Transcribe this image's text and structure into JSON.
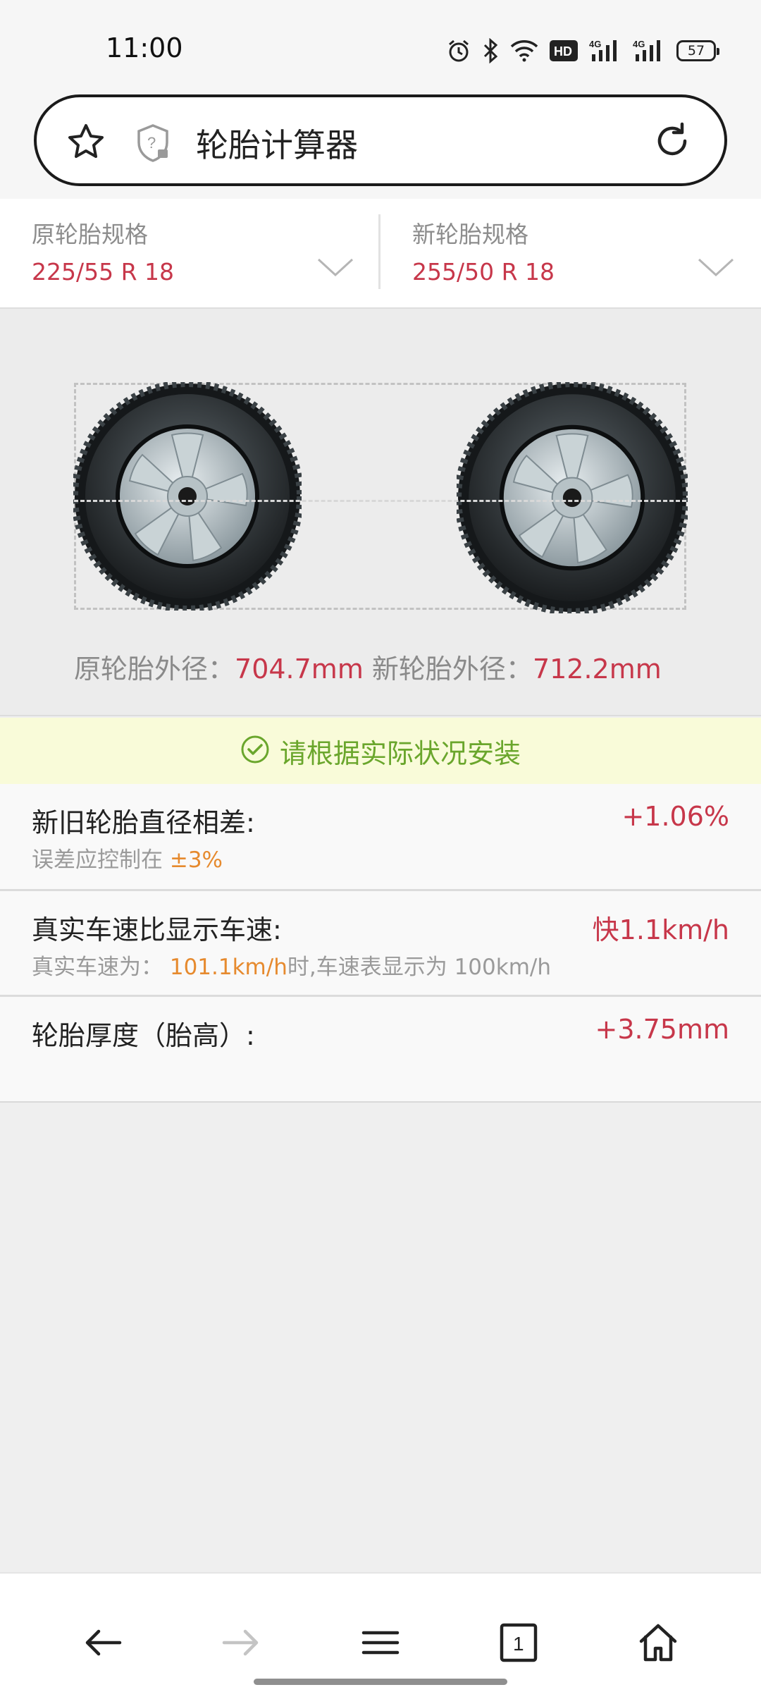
{
  "status_bar": {
    "time": "11:00",
    "battery": "57",
    "icons": [
      "alarm-icon",
      "bluetooth-icon",
      "wifi-icon",
      "hd-icon",
      "4g-signal-icon",
      "4g-signal-icon",
      "battery-icon"
    ],
    "hd_label": "HD",
    "net_label": "4G"
  },
  "url_bar": {
    "title": "轮胎计算器"
  },
  "specs": {
    "original": {
      "label": "原轮胎规格",
      "value": "225/55 R 18"
    },
    "new": {
      "label": "新轮胎规格",
      "value": "255/50 R 18"
    }
  },
  "diameters": {
    "original_label": "原轮胎外径：",
    "original_value": "704.7mm",
    "new_label": " 新轮胎外径：",
    "new_value": "712.2mm"
  },
  "notice": {
    "text": "请根据实际状况安装"
  },
  "results": {
    "diameter_diff": {
      "title": "新旧轮胎直径相差:",
      "value": "+1.06%",
      "sub_prefix": "误差应控制在 ",
      "sub_highlight": "±3%"
    },
    "speed": {
      "title": "真实车速比显示车速:",
      "value": "快1.1km/h",
      "sub_prefix": "真实车速为：  ",
      "sub_highlight": "101.1km/h",
      "sub_suffix": "时,车速表显示为 100km/h"
    },
    "thickness": {
      "title": "轮胎厚度（胎高）:",
      "value": "+3.75mm"
    }
  },
  "colors": {
    "accent_red": "#c7374a",
    "highlight_orange": "#e68a2e",
    "notice_green": "#6aa62c",
    "notice_bg": "#f9fbd9"
  },
  "bottom_nav": {
    "tab_count": "1",
    "icons": [
      "back-arrow-icon",
      "forward-arrow-icon",
      "menu-icon",
      "tabs-icon",
      "home-icon"
    ]
  }
}
